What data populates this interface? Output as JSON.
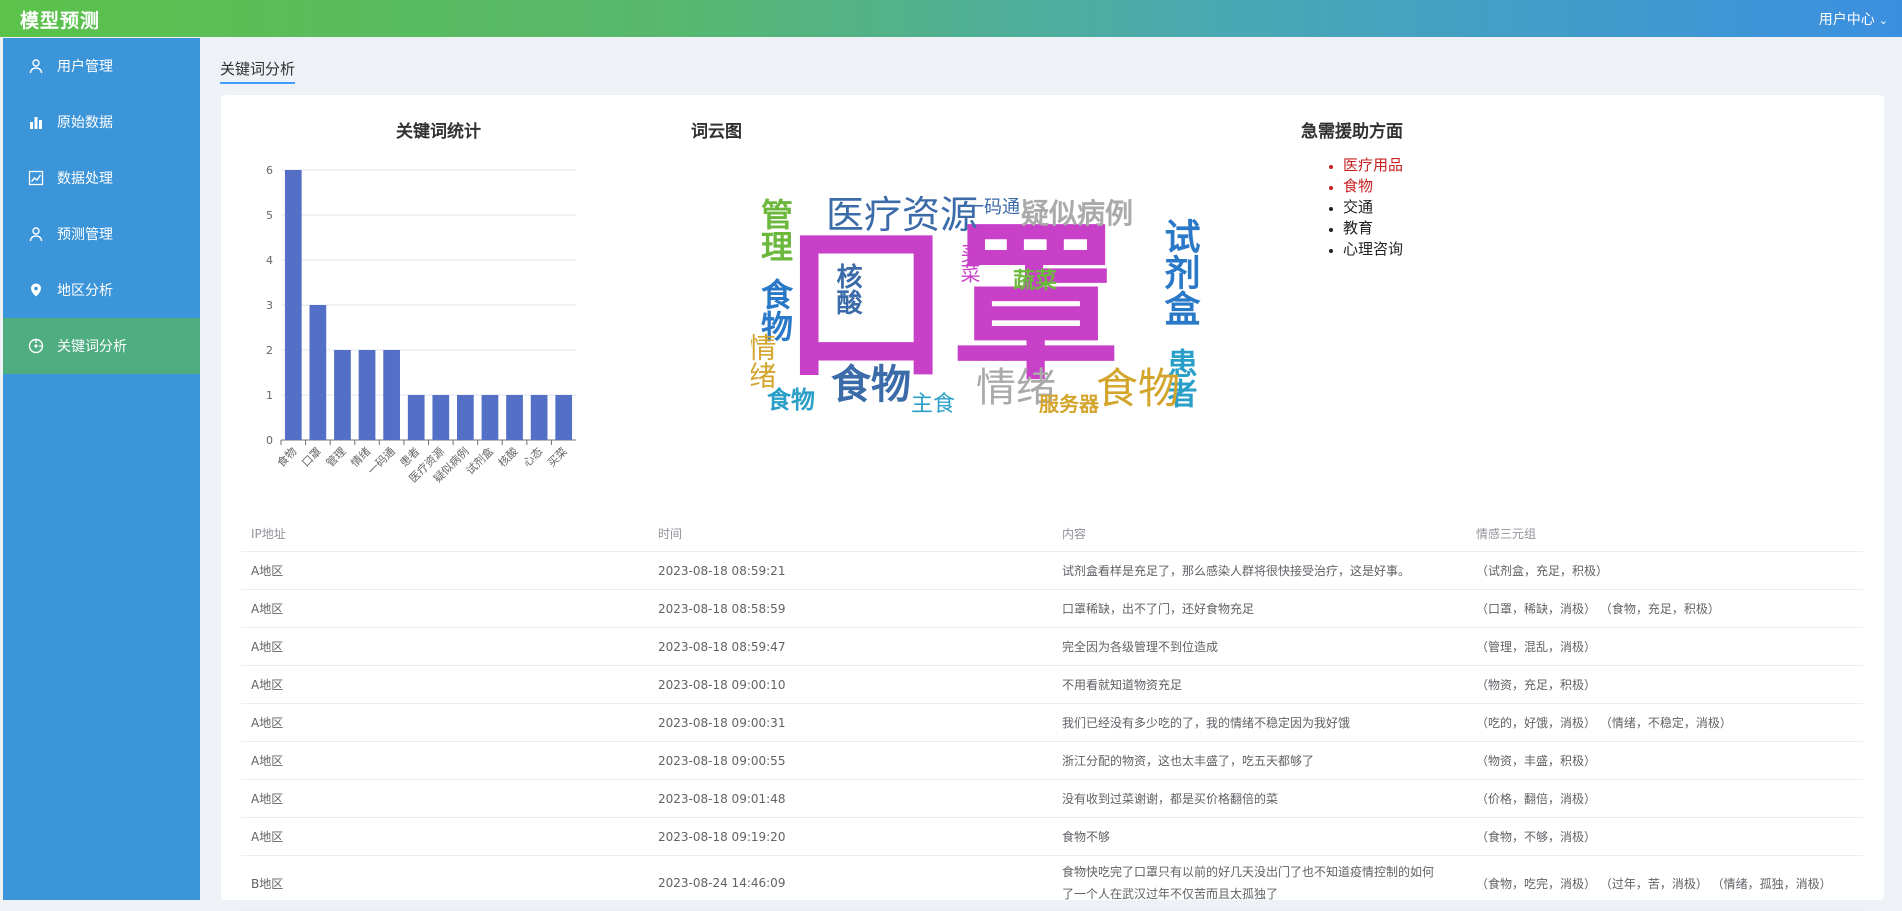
{
  "header": {
    "brand": "模型预测",
    "user_center": "用户中心"
  },
  "sidebar": {
    "items": [
      {
        "label": "用户管理",
        "icon": "user-icon"
      },
      {
        "label": "原始数据",
        "icon": "bar-chart-icon"
      },
      {
        "label": "数据处理",
        "icon": "trend-icon"
      },
      {
        "label": "预测管理",
        "icon": "user-icon"
      },
      {
        "label": "地区分析",
        "icon": "location-pin-icon"
      },
      {
        "label": "关键词分析",
        "icon": "compass-icon",
        "active": true
      }
    ]
  },
  "tab": {
    "label": "关键词分析"
  },
  "sections": {
    "keyword_stats": "关键词统计",
    "wordcloud": "词云图",
    "urgent_aid": "急需援助方面"
  },
  "chart_data": {
    "type": "bar",
    "title": "关键词统计",
    "categories": [
      "食物",
      "口罩",
      "管理",
      "情绪",
      "一码通",
      "患者",
      "医疗资源",
      "疑似病例",
      "试剂盒",
      "核酸",
      "心态",
      "买菜"
    ],
    "values": [
      6,
      3,
      2,
      2,
      2,
      1,
      1,
      1,
      1,
      1,
      1,
      1
    ],
    "ylim": [
      0,
      6
    ],
    "yticks": [
      0,
      1,
      2,
      3,
      4,
      5,
      6
    ],
    "grid": true,
    "color": "#5470c6"
  },
  "wordcloud": {
    "words": [
      {
        "text": "口罩",
        "color": "#c83fc8"
      },
      {
        "text": "食物",
        "color": "#d4a52c"
      },
      {
        "text": "食物",
        "color": "#3b6ba8"
      },
      {
        "text": "医疗资源",
        "color": "#3b6ba8"
      },
      {
        "text": "疑似病例",
        "color": "#aaaaaa"
      },
      {
        "text": "试剂盒",
        "color": "#2a78c8"
      },
      {
        "text": "患者",
        "color": "#2a9fc8"
      },
      {
        "text": "管理",
        "color": "#6bb83c"
      },
      {
        "text": "食物",
        "color": "#2a78c8"
      },
      {
        "text": "情绪",
        "color": "#d4a52c"
      },
      {
        "text": "情绪",
        "color": "#aaaaaa"
      },
      {
        "text": "核酸",
        "color": "#3b6ba8"
      },
      {
        "text": "蔬菜",
        "color": "#6bb83c"
      },
      {
        "text": "食物",
        "color": "#2a9fc8"
      },
      {
        "text": "主食",
        "color": "#2a9fc8"
      },
      {
        "text": "服务器",
        "color": "#d4a52c"
      },
      {
        "text": "一码通",
        "color": "#3b6ba8"
      },
      {
        "text": "买菜",
        "color": "#c83fc8"
      }
    ]
  },
  "urgent_aid": {
    "items": [
      {
        "label": "医疗用品",
        "color": "#c82020"
      },
      {
        "label": "食物",
        "color": "#c82020"
      },
      {
        "label": "交通",
        "color": "#222222"
      },
      {
        "label": "教育",
        "color": "#222222"
      },
      {
        "label": "心理咨询",
        "color": "#222222"
      }
    ]
  },
  "table": {
    "headers": [
      "IP地址",
      "时间",
      "内容",
      "情感三元组"
    ],
    "rows": [
      [
        "A地区",
        "2023-08-18 08:59:21",
        "试剂盒看样是充足了，那么感染人群将很快接受治疗，这是好事。",
        "（试剂盒，充足，积极）"
      ],
      [
        "A地区",
        "2023-08-18 08:58:59",
        "口罩稀缺，出不了门，还好食物充足",
        "（口罩，稀缺，消极） （食物，充足，积极）"
      ],
      [
        "A地区",
        "2023-08-18 08:59:47",
        "完全因为各级管理不到位造成",
        "（管理，混乱，消极）"
      ],
      [
        "A地区",
        "2023-08-18 09:00:10",
        "不用看就知道物资充足",
        "（物资，充足，积极）"
      ],
      [
        "A地区",
        "2023-08-18 09:00:31",
        "我们已经没有多少吃的了，我的情绪不稳定因为我好饿",
        "（吃的，好饿，消极） （情绪，不稳定，消极）"
      ],
      [
        "A地区",
        "2023-08-18 09:00:55",
        "浙江分配的物资，这也太丰盛了，吃五天都够了",
        "（物资，丰盛，积极）"
      ],
      [
        "A地区",
        "2023-08-18 09:01:48",
        "没有收到过菜谢谢，都是买价格翻倍的菜",
        "（价格，翻倍，消极）"
      ],
      [
        "A地区",
        "2023-08-18 09:19:20",
        "食物不够",
        "（食物，不够，消极）"
      ],
      [
        "B地区",
        "2023-08-24 14:46:09",
        "食物快吃完了口罩只有以前的好几天没出门了也不知道疫情控制的如何了一个人在武汉过年不仅苦而且太孤独了",
        "（食物，吃完，消极） （过年，苦，消极） （情绪，孤独，消极）"
      ]
    ]
  }
}
